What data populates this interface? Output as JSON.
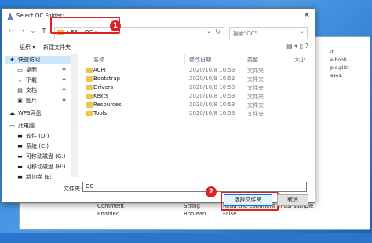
{
  "background": {
    "rows": [
      {
        "key": "Comment",
        "type": "String",
        "value": "Read the comment in dsl sample"
      },
      {
        "key": "Enabled",
        "type": "Boolean",
        "value": "False"
      }
    ],
    "side_text": [
      "it.",
      "e booti",
      "ple.plist",
      "ases."
    ]
  },
  "dialog": {
    "title": "Select OC Folder:",
    "close": "✕",
    "nav": {
      "back": "←",
      "forward": "→",
      "recent": "⌄",
      "up": "↑"
    },
    "address": {
      "crumbs": "›  EFI  ›  OC  ›",
      "dropdown": "⌄",
      "refresh": "↻"
    },
    "search": {
      "placeholder": "搜索\"OC\"",
      "icon": "⌕"
    },
    "badges": {
      "address": "1",
      "select": "2"
    },
    "toolbar": {
      "organize": "组织 ▾",
      "new_folder": "新建文件夹",
      "view_icons": "▤ ▾  ▯  ?"
    },
    "sidebar": [
      {
        "label": "快速访问",
        "icon": "★",
        "pinned": false,
        "selected": true
      },
      {
        "label": "桌面",
        "icon": "▭",
        "pinned": true
      },
      {
        "label": "下载",
        "icon": "↓",
        "pinned": true
      },
      {
        "label": "文档",
        "icon": "▤",
        "pinned": true
      },
      {
        "label": "图片",
        "icon": "▣",
        "pinned": true
      },
      {
        "label": "WPS网盘",
        "icon": "☁",
        "pinned": false
      },
      {
        "label": "此电脑",
        "icon": "▭",
        "pinned": false
      },
      {
        "label": "软件 (D:)",
        "icon": "▬",
        "pinned": false
      },
      {
        "label": "系统 (C:)",
        "icon": "▬",
        "pinned": false
      },
      {
        "label": "可移动磁盘 (G:)",
        "icon": "▬",
        "pinned": false
      },
      {
        "label": "可移动磁盘 (H:)",
        "icon": "▬",
        "pinned": false
      },
      {
        "label": "新加卷 (E:)",
        "icon": "▬",
        "pinned": false
      }
    ],
    "columns": {
      "name": "名称",
      "date": "修改日期",
      "type": "类型",
      "size": "大小"
    },
    "files": [
      {
        "name": "ACPI",
        "date": "2020/10/8 10:53",
        "type": "文件夹"
      },
      {
        "name": "Bootstrap",
        "date": "2020/10/8 10:53",
        "type": "文件夹"
      },
      {
        "name": "Drivers",
        "date": "2020/10/8 10:53",
        "type": "文件夹"
      },
      {
        "name": "Kexts",
        "date": "2020/10/8 10:53",
        "type": "文件夹"
      },
      {
        "name": "Resources",
        "date": "2020/10/8 10:53",
        "type": "文件夹"
      },
      {
        "name": "Tools",
        "date": "2020/10/8 10:53",
        "type": "文件夹"
      }
    ],
    "footer": {
      "label": "文件夹:",
      "value": "OC",
      "select_button": "选择文件夹",
      "cancel_button": "取消"
    }
  },
  "colors": {
    "highlight": "#e32020",
    "folder": "#f0c64a",
    "selected": "#cce8ff"
  }
}
